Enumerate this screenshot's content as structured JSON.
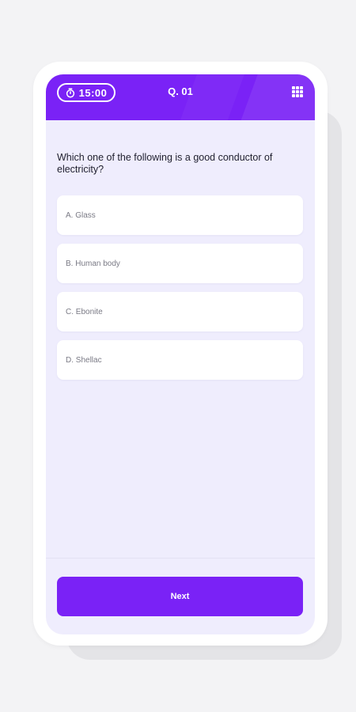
{
  "header": {
    "timer": "15:00",
    "question_number": "Q. 01",
    "timer_icon": "stopwatch-icon",
    "menu_icon": "grid-icon"
  },
  "question": {
    "text": "Which one of the following is a good conductor of electricity?"
  },
  "options": [
    {
      "label": "A. Glass"
    },
    {
      "label": "B. Human body"
    },
    {
      "label": "C. Ebonite"
    },
    {
      "label": "D. Shellac"
    }
  ],
  "footer": {
    "next_label": "Next"
  },
  "colors": {
    "accent": "#7a22f6",
    "screen_bg": "#efedfd",
    "page_bg": "#f3f3f5"
  }
}
